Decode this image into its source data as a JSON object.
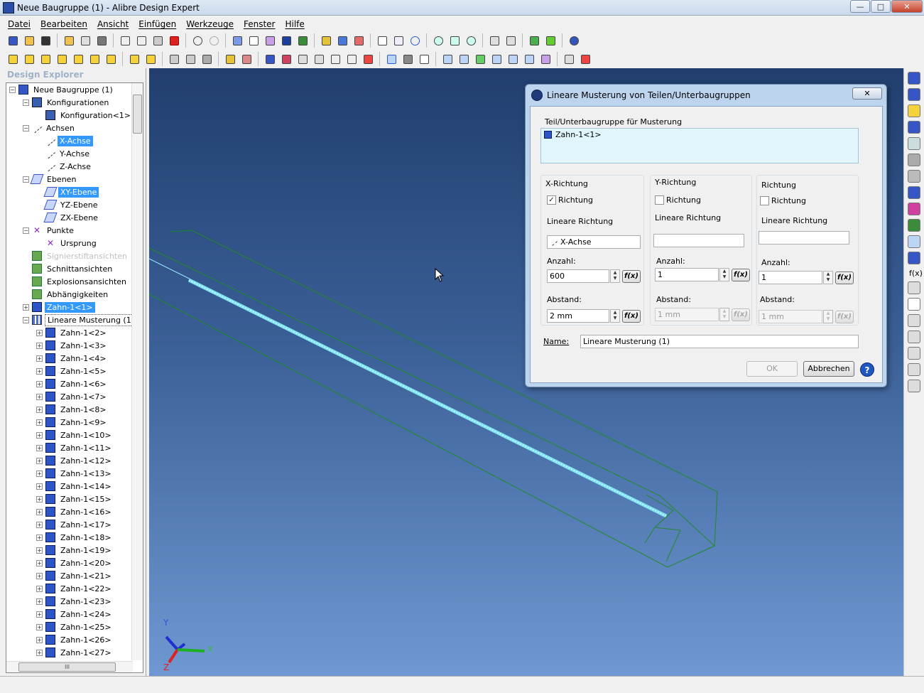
{
  "window": {
    "title": "Neue Baugruppe (1) - Alibre Design Expert",
    "min": "—",
    "max": "□",
    "close": "✕"
  },
  "menu": [
    "Datei",
    "Bearbeiten",
    "Ansicht",
    "Einfügen",
    "Werkzeuge",
    "Fenster",
    "Hilfe"
  ],
  "explorer": {
    "title": "Design Explorer",
    "tree": [
      {
        "label": "Neue Baugruppe (1)",
        "indent": 0,
        "exp": "−",
        "icon": "asm"
      },
      {
        "label": "Konfigurationen",
        "indent": 1,
        "exp": "−",
        "icon": "cfg"
      },
      {
        "label": "Konfiguration<1>",
        "indent": 2,
        "exp": "",
        "icon": "cfg"
      },
      {
        "label": "Achsen",
        "indent": 1,
        "exp": "−",
        "icon": "axis"
      },
      {
        "label": "X-Achse",
        "indent": 2,
        "exp": "",
        "icon": "axis",
        "selected": true
      },
      {
        "label": "Y-Achse",
        "indent": 2,
        "exp": "",
        "icon": "axis"
      },
      {
        "label": "Z-Achse",
        "indent": 2,
        "exp": "",
        "icon": "axis"
      },
      {
        "label": "Ebenen",
        "indent": 1,
        "exp": "−",
        "icon": "plane"
      },
      {
        "label": "XY-Ebene",
        "indent": 2,
        "exp": "",
        "icon": "plane",
        "selected": true
      },
      {
        "label": "YZ-Ebene",
        "indent": 2,
        "exp": "",
        "icon": "plane"
      },
      {
        "label": "ZX-Ebene",
        "indent": 2,
        "exp": "",
        "icon": "plane"
      },
      {
        "label": "Punkte",
        "indent": 1,
        "exp": "−",
        "icon": "pt"
      },
      {
        "label": "Ursprung",
        "indent": 2,
        "exp": "",
        "icon": "pt"
      },
      {
        "label": "Signierstiftansichten",
        "indent": 1,
        "exp": "",
        "icon": "misc",
        "dim": true
      },
      {
        "label": "Schnittansichten",
        "indent": 1,
        "exp": "",
        "icon": "misc"
      },
      {
        "label": "Explosionsansichten",
        "indent": 1,
        "exp": "",
        "icon": "misc"
      },
      {
        "label": "Abhängigkeiten",
        "indent": 1,
        "exp": "",
        "icon": "misc"
      },
      {
        "label": "Zahn-1<1>",
        "indent": 1,
        "exp": "+",
        "icon": "part",
        "selected": true
      },
      {
        "label": "Lineare Musterung (1)",
        "indent": 1,
        "exp": "−",
        "icon": "pat",
        "boxed": true
      },
      {
        "label": "Zahn-1<2>",
        "indent": 2,
        "exp": "+",
        "icon": "part"
      },
      {
        "label": "Zahn-1<3>",
        "indent": 2,
        "exp": "+",
        "icon": "part"
      },
      {
        "label": "Zahn-1<4>",
        "indent": 2,
        "exp": "+",
        "icon": "part"
      },
      {
        "label": "Zahn-1<5>",
        "indent": 2,
        "exp": "+",
        "icon": "part"
      },
      {
        "label": "Zahn-1<6>",
        "indent": 2,
        "exp": "+",
        "icon": "part"
      },
      {
        "label": "Zahn-1<7>",
        "indent": 2,
        "exp": "+",
        "icon": "part"
      },
      {
        "label": "Zahn-1<8>",
        "indent": 2,
        "exp": "+",
        "icon": "part"
      },
      {
        "label": "Zahn-1<9>",
        "indent": 2,
        "exp": "+",
        "icon": "part"
      },
      {
        "label": "Zahn-1<10>",
        "indent": 2,
        "exp": "+",
        "icon": "part"
      },
      {
        "label": "Zahn-1<11>",
        "indent": 2,
        "exp": "+",
        "icon": "part"
      },
      {
        "label": "Zahn-1<12>",
        "indent": 2,
        "exp": "+",
        "icon": "part"
      },
      {
        "label": "Zahn-1<13>",
        "indent": 2,
        "exp": "+",
        "icon": "part"
      },
      {
        "label": "Zahn-1<14>",
        "indent": 2,
        "exp": "+",
        "icon": "part"
      },
      {
        "label": "Zahn-1<15>",
        "indent": 2,
        "exp": "+",
        "icon": "part"
      },
      {
        "label": "Zahn-1<16>",
        "indent": 2,
        "exp": "+",
        "icon": "part"
      },
      {
        "label": "Zahn-1<17>",
        "indent": 2,
        "exp": "+",
        "icon": "part"
      },
      {
        "label": "Zahn-1<18>",
        "indent": 2,
        "exp": "+",
        "icon": "part"
      },
      {
        "label": "Zahn-1<19>",
        "indent": 2,
        "exp": "+",
        "icon": "part"
      },
      {
        "label": "Zahn-1<20>",
        "indent": 2,
        "exp": "+",
        "icon": "part"
      },
      {
        "label": "Zahn-1<21>",
        "indent": 2,
        "exp": "+",
        "icon": "part"
      },
      {
        "label": "Zahn-1<22>",
        "indent": 2,
        "exp": "+",
        "icon": "part"
      },
      {
        "label": "Zahn-1<23>",
        "indent": 2,
        "exp": "+",
        "icon": "part"
      },
      {
        "label": "Zahn-1<24>",
        "indent": 2,
        "exp": "+",
        "icon": "part"
      },
      {
        "label": "Zahn-1<25>",
        "indent": 2,
        "exp": "+",
        "icon": "part"
      },
      {
        "label": "Zahn-1<26>",
        "indent": 2,
        "exp": "+",
        "icon": "part"
      },
      {
        "label": "Zahn-1<27>",
        "indent": 2,
        "exp": "+",
        "icon": "part"
      }
    ],
    "hscroll_label": "III"
  },
  "triad": {
    "x": "X",
    "y": "Y",
    "z": "Z"
  },
  "dialog": {
    "title": "Lineare Musterung von Teilen/Unterbaugruppen",
    "close": "✕",
    "teil_label": "Teil/Unterbaugruppe für Musterung",
    "teil_value": "Zahn-1<1>",
    "x": {
      "header": "X-Richtung",
      "checkbox_label": "Richtung",
      "checked": true,
      "richtung_label": "Lineare Richtung",
      "richtung_value": "X-Achse",
      "anzahl_label": "Anzahl:",
      "anzahl_value": "600",
      "abstand_label": "Abstand:",
      "abstand_value": "2 mm"
    },
    "y": {
      "header": "Y-Richtung",
      "checkbox_label": "Richtung",
      "checked": false,
      "richtung_label": "Lineare Richtung",
      "richtung_value": "",
      "anzahl_label": "Anzahl:",
      "anzahl_value": "1",
      "abstand_label": "Abstand:",
      "abstand_value": "1 mm"
    },
    "z": {
      "header": "Richtung",
      "checkbox_label": "Richtung",
      "checked": false,
      "richtung_label": "Lineare Richtung",
      "richtung_value": "",
      "anzahl_label": "Anzahl:",
      "anzahl_value": "1",
      "abstand_label": "Abstand:",
      "abstand_value": "1 mm"
    },
    "fx_label": "f(x)",
    "name_label": "Name:",
    "name_value": "Lineare Musterung (1)",
    "ok_label": "OK",
    "cancel_label": "Abbrechen",
    "help_label": "?"
  },
  "right_toolbar": {
    "fx_label": "f(x)"
  }
}
